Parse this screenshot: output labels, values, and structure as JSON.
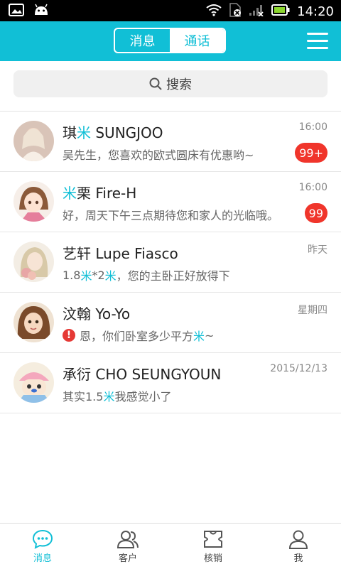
{
  "statusbar": {
    "time": "14:20"
  },
  "header": {
    "tabs": [
      {
        "label": "消息",
        "active": true
      },
      {
        "label": "通话",
        "active": false
      }
    ]
  },
  "search": {
    "label": "搜索"
  },
  "conversations": [
    {
      "name_parts": [
        {
          "text": "琪",
          "hl": false
        },
        {
          "text": "米",
          "hl": true
        },
        {
          "text": " SUNGJOO",
          "hl": false
        }
      ],
      "time": "16:00",
      "msg_parts": [
        {
          "text": "吴先生，您喜欢的欧式圆床有优惠哟~",
          "hl": false
        }
      ],
      "badge": "99+",
      "warning": false
    },
    {
      "name_parts": [
        {
          "text": "米",
          "hl": true
        },
        {
          "text": "栗 Fire-H",
          "hl": false
        }
      ],
      "time": "16:00",
      "msg_parts": [
        {
          "text": "好，周天下午三点期待您和家人的光临哦。",
          "hl": false
        }
      ],
      "badge": "99",
      "warning": false
    },
    {
      "name_parts": [
        {
          "text": "艺轩 Lupe Fiasco",
          "hl": false
        }
      ],
      "time": "昨天",
      "msg_parts": [
        {
          "text": "1.8",
          "hl": false
        },
        {
          "text": "米",
          "hl": true
        },
        {
          "text": "*2",
          "hl": false
        },
        {
          "text": "米",
          "hl": true
        },
        {
          "text": "，您的主卧正好放得下",
          "hl": false
        }
      ],
      "badge": "",
      "warning": false
    },
    {
      "name_parts": [
        {
          "text": "汶翰 Yo-Yo",
          "hl": false
        }
      ],
      "time": "星期四",
      "msg_parts": [
        {
          "text": "恩，你们卧室多少平方",
          "hl": false
        },
        {
          "text": "米",
          "hl": true
        },
        {
          "text": "~",
          "hl": false
        }
      ],
      "badge": "",
      "warning": true
    },
    {
      "name_parts": [
        {
          "text": "承衍 CHO SEUNGYOUN",
          "hl": false
        }
      ],
      "time": "2015/12/13",
      "msg_parts": [
        {
          "text": "其实1.5",
          "hl": false
        },
        {
          "text": "米",
          "hl": true
        },
        {
          "text": "我感觉小了",
          "hl": false
        }
      ],
      "badge": "",
      "warning": false
    }
  ],
  "bottom_nav": [
    {
      "label": "消息",
      "active": true,
      "icon": "chat-bubble-icon"
    },
    {
      "label": "客户",
      "active": false,
      "icon": "customers-icon"
    },
    {
      "label": "核销",
      "active": false,
      "icon": "verify-icon"
    },
    {
      "label": "我",
      "active": false,
      "icon": "profile-icon"
    }
  ],
  "colors": {
    "accent": "#11bfd6",
    "badge": "#f0352b"
  }
}
